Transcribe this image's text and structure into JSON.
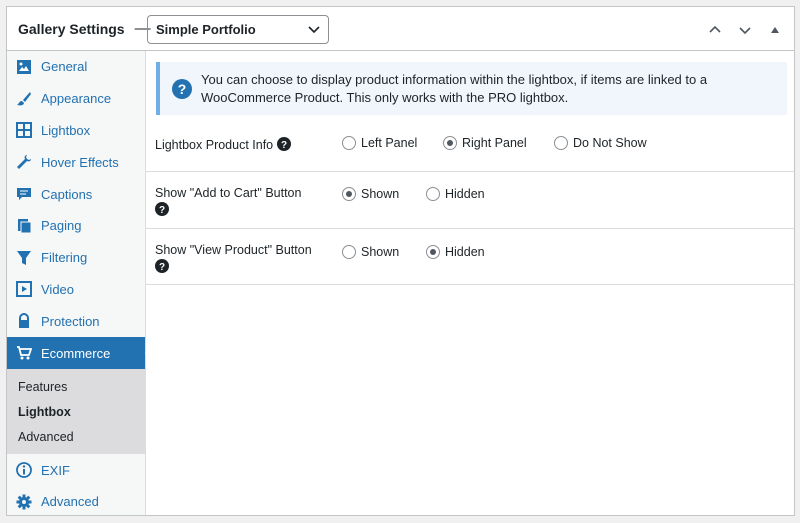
{
  "header": {
    "title": "Gallery Settings",
    "dash": "—",
    "template_select": "Simple Portfolio"
  },
  "sidebar": {
    "items": [
      {
        "label": "General",
        "icon": "image-icon"
      },
      {
        "label": "Appearance",
        "icon": "brush-icon"
      },
      {
        "label": "Lightbox",
        "icon": "grid-icon"
      },
      {
        "label": "Hover Effects",
        "icon": "wrench-icon"
      },
      {
        "label": "Captions",
        "icon": "comment-icon"
      },
      {
        "label": "Paging",
        "icon": "pages-icon"
      },
      {
        "label": "Filtering",
        "icon": "filter-icon"
      },
      {
        "label": "Video",
        "icon": "video-icon"
      },
      {
        "label": "Protection",
        "icon": "lock-icon"
      },
      {
        "label": "Ecommerce",
        "icon": "cart-icon",
        "active": true
      }
    ],
    "subitems": [
      "Features",
      "Lightbox",
      "Advanced"
    ],
    "after_items": [
      {
        "label": "EXIF",
        "icon": "info-icon"
      },
      {
        "label": "Advanced",
        "icon": "gear-icon"
      }
    ]
  },
  "notice": {
    "text": "You can choose to display product information within the lightbox, if items are linked to a WooCommerce Product. This only works with the PRO lightbox."
  },
  "settings": [
    {
      "label": "Lightbox Product Info",
      "options": [
        "Left Panel",
        "Right Panel",
        "Do Not Show"
      ],
      "selected": "Right Panel"
    },
    {
      "label": "Show \"Add to Cart\" Button",
      "options": [
        "Shown",
        "Hidden"
      ],
      "selected": "Shown"
    },
    {
      "label": "Show \"View Product\" Button",
      "options": [
        "Shown",
        "Hidden"
      ],
      "selected": "Hidden"
    }
  ],
  "colors": {
    "accent": "#2271b1",
    "notice_border": "#72aee6",
    "notice_bg": "#f0f6fc"
  }
}
